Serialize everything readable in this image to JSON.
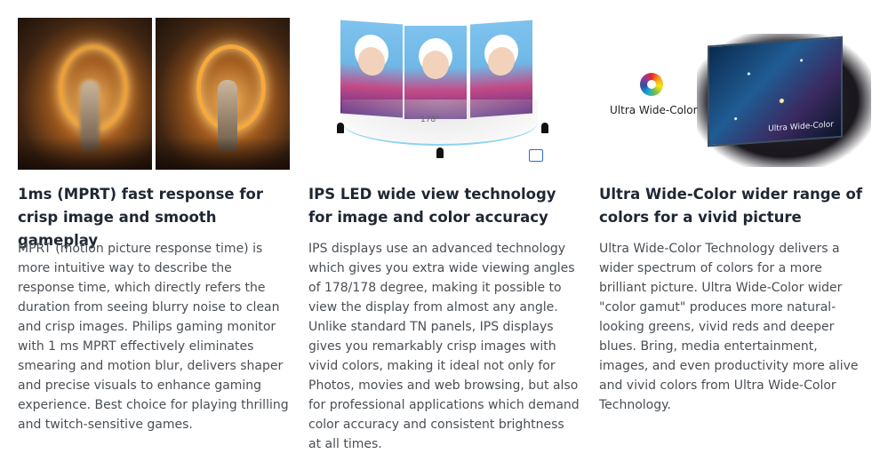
{
  "features": [
    {
      "title": "1ms (MPRT) fast response for crisp image and smooth gameplay",
      "body": "MPRT (motion picture response time) is more intuitive way to describe the response time, which directly refers the duration from seeing blurry noise to clean and crisp images. Philips gaming monitor with 1 ms MPRT effectively eliminates smearing and motion blur, delivers shaper and precise visuals to enhance gaming experience. Best choice for playing thrilling and twitch-sensitive games."
    },
    {
      "title": "IPS LED wide view technology for image and color accuracy",
      "body": "IPS displays use an advanced technology which gives you extra wide viewing angles of 178/178 degree, making it possible to view the display from almost any angle. Unlike standard TN panels, IPS displays gives you remarkably crisp images with vivid colors, making it ideal not only for Photos, movies and web browsing, but also for professional applications which demand color accuracy and consistent brightness at all times.",
      "image_angle_label": "178°"
    },
    {
      "title": "Ultra Wide-Color wider range of colors for a vivid picture",
      "body": "Ultra Wide-Color Technology delivers a wider spectrum of colors for a more brilliant picture. Ultra Wide-Color wider \"color gamut\" produces more natural-looking greens, vivid reds and deeper blues. Bring, media entertainment, images, and even productivity more alive and vivid colors from Ultra Wide-Color Technology.",
      "image_logo_label": "Ultra Wide-Color",
      "image_screen_label": "Ultra Wide-Color"
    }
  ]
}
